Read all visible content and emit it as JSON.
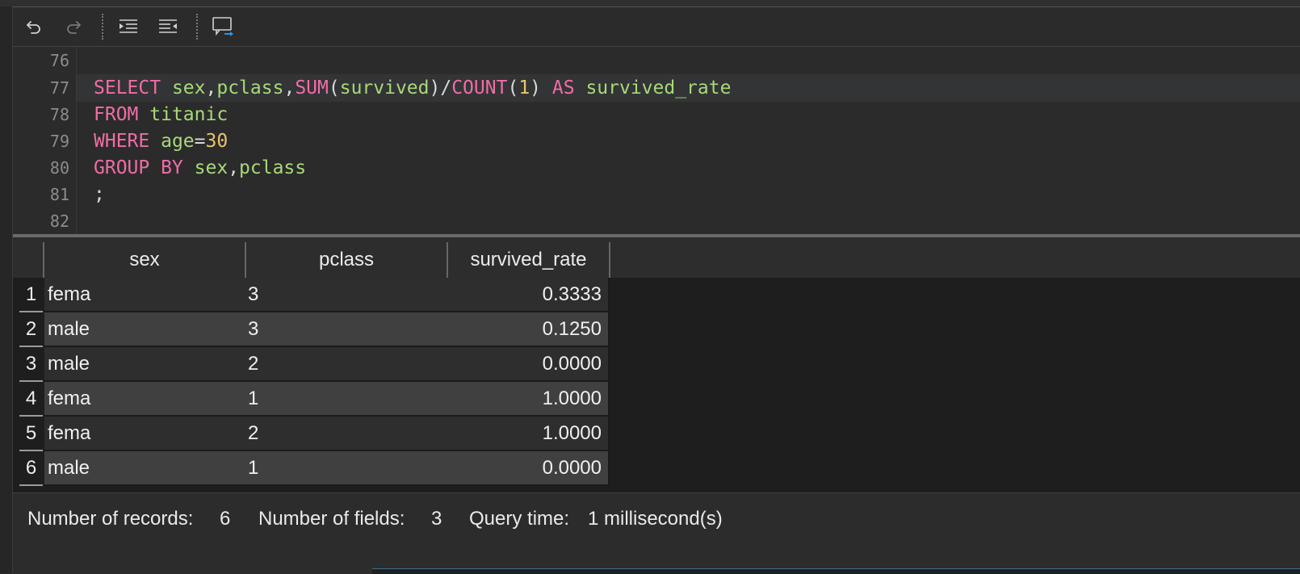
{
  "toolbar": {
    "buttons": [
      {
        "name": "undo-icon"
      },
      {
        "name": "redo-icon"
      },
      {
        "name": "indent-icon"
      },
      {
        "name": "outdent-icon"
      },
      {
        "name": "execute-to-result-icon"
      }
    ]
  },
  "editor": {
    "line_numbers": [
      "76",
      "77",
      "78",
      "79",
      "80",
      "81",
      "82"
    ],
    "lines": [
      [],
      [
        {
          "t": "SELECT",
          "k": "kw"
        },
        {
          "t": " ",
          "k": "pl"
        },
        {
          "t": "sex",
          "k": "id"
        },
        {
          "t": ",",
          "k": "pl"
        },
        {
          "t": "pclass",
          "k": "id"
        },
        {
          "t": ",",
          "k": "pl"
        },
        {
          "t": "SUM",
          "k": "kw"
        },
        {
          "t": "(",
          "k": "pl"
        },
        {
          "t": "survived",
          "k": "id"
        },
        {
          "t": ")/",
          "k": "pl"
        },
        {
          "t": "COUNT",
          "k": "kw"
        },
        {
          "t": "(",
          "k": "pl"
        },
        {
          "t": "1",
          "k": "num"
        },
        {
          "t": ") ",
          "k": "pl"
        },
        {
          "t": "AS",
          "k": "kw"
        },
        {
          "t": " ",
          "k": "pl"
        },
        {
          "t": "survived_rate",
          "k": "id"
        }
      ],
      [
        {
          "t": "FROM",
          "k": "kw"
        },
        {
          "t": " ",
          "k": "pl"
        },
        {
          "t": "titanic",
          "k": "id"
        }
      ],
      [
        {
          "t": "WHERE",
          "k": "kw"
        },
        {
          "t": " ",
          "k": "pl"
        },
        {
          "t": "age",
          "k": "id"
        },
        {
          "t": "=",
          "k": "pl"
        },
        {
          "t": "30",
          "k": "num"
        }
      ],
      [
        {
          "t": "GROUP BY",
          "k": "kw"
        },
        {
          "t": " ",
          "k": "pl"
        },
        {
          "t": "sex",
          "k": "id"
        },
        {
          "t": ",",
          "k": "pl"
        },
        {
          "t": "pclass",
          "k": "id"
        }
      ],
      [
        {
          "t": ";",
          "k": "pl"
        }
      ],
      []
    ]
  },
  "results": {
    "columns": [
      "sex",
      "pclass",
      "survived_rate"
    ],
    "rows": [
      {
        "n": "1",
        "sex": "fema",
        "pclass": "3",
        "rate": "0.3333"
      },
      {
        "n": "2",
        "sex": "male",
        "pclass": "3",
        "rate": "0.1250"
      },
      {
        "n": "3",
        "sex": "male",
        "pclass": "2",
        "rate": "0.0000"
      },
      {
        "n": "4",
        "sex": "fema",
        "pclass": "1",
        "rate": "1.0000"
      },
      {
        "n": "5",
        "sex": "fema",
        "pclass": "2",
        "rate": "1.0000"
      },
      {
        "n": "6",
        "sex": "male",
        "pclass": "1",
        "rate": "0.0000"
      }
    ]
  },
  "status": {
    "records_label": "Number of records:",
    "records_value": "6",
    "fields_label": "Number of fields:",
    "fields_value": "3",
    "time_label": "Query time:",
    "time_value": "1 millisecond(s)"
  },
  "colors": {
    "keyword": "#ef6da6",
    "identifier": "#a8d979",
    "number": "#e8c66a",
    "accent": "#2f8fe0"
  }
}
